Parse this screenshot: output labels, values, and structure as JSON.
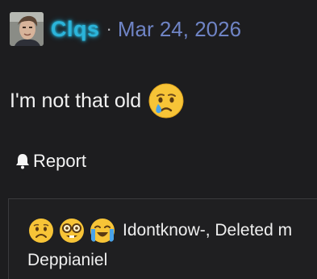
{
  "post": {
    "username": "Clqs",
    "separator": "·",
    "date": "Mar 24, 2026",
    "message": "I'm not that old",
    "message_emoji": "crying-face-emoji",
    "report_label": "Report"
  },
  "reactions": {
    "emojis": [
      "sad-face-emoji",
      "nerd-face-emoji",
      "loudly-crying-face-emoji"
    ],
    "names_line1": "Idontknow-, Deleted m",
    "names_line2": "Deppianiel"
  },
  "colors": {
    "background": "#1d1d1f",
    "username": "#2bb4da",
    "date": "#6f84c5",
    "text": "#f1f1f1"
  }
}
